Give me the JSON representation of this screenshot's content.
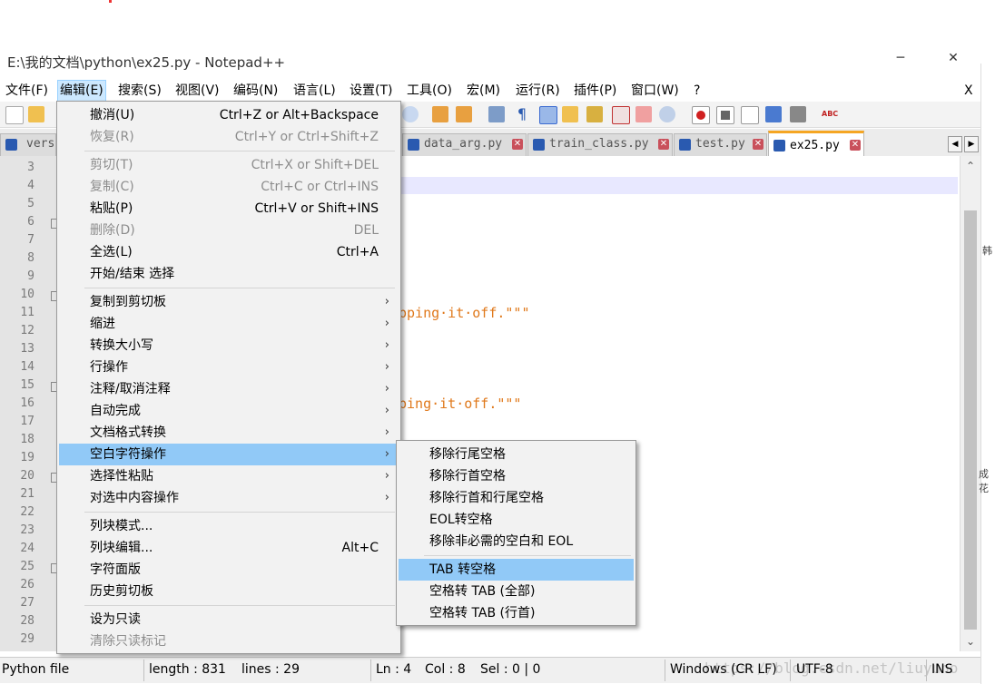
{
  "window": {
    "title": "E:\\我的文档\\python\\ex25.py - Notepad++",
    "minimize_label": "─",
    "close_label": "✕"
  },
  "menubar": {
    "items": [
      "文件(F)",
      "编辑(E)",
      "搜索(S)",
      "视图(V)",
      "编码(N)",
      "语言(L)",
      "设置(T)",
      "工具(O)",
      "宏(M)",
      "运行(R)",
      "插件(P)",
      "窗口(W)",
      "?"
    ],
    "close_label": "X"
  },
  "tabs": [
    {
      "name": "vers",
      "active": false
    },
    {
      "name": "data_arg.py",
      "active": false
    },
    {
      "name": "train_class.py",
      "active": false
    },
    {
      "name": "test.py",
      "active": false
    },
    {
      "name": "ex25.py",
      "active": true
    }
  ],
  "tab_close_glyph": "✕",
  "tab_nav": {
    "prev": "◀",
    "next": "▶"
  },
  "editor": {
    "line_numbers": [
      "3",
      "4",
      "5",
      "6",
      "7",
      "8",
      "9",
      "10",
      "11",
      "12",
      "13",
      "14",
      "15",
      "16",
      "17",
      "18",
      "19",
      "20",
      "21",
      "22",
      "23",
      "24",
      "25",
      "26",
      "27",
      "28",
      "29"
    ],
    "visible_code": [
      {
        "line": "11",
        "text": "pping·it·off.\"\"\""
      },
      {
        "line": "16",
        "text": "ping·it·off.\"\"\""
      }
    ]
  },
  "edit_menu": {
    "items": [
      {
        "label": "撤消(U)",
        "shortcut": "Ctrl+Z or Alt+Backspace",
        "disabled": false
      },
      {
        "label": "恢复(R)",
        "shortcut": "Ctrl+Y or Ctrl+Shift+Z",
        "disabled": true
      },
      {
        "label": "剪切(T)",
        "shortcut": "Ctrl+X or Shift+DEL",
        "disabled": true
      },
      {
        "label": "复制(C)",
        "shortcut": "Ctrl+C or Ctrl+INS",
        "disabled": true
      },
      {
        "label": "粘贴(P)",
        "shortcut": "Ctrl+V or Shift+INS",
        "disabled": false
      },
      {
        "label": "删除(D)",
        "shortcut": "DEL",
        "disabled": true
      },
      {
        "label": "全选(L)",
        "shortcut": "Ctrl+A",
        "disabled": false
      },
      {
        "label": "开始/结束 选择",
        "shortcut": "",
        "disabled": false
      },
      {
        "label": "复制到剪切板",
        "submenu": true
      },
      {
        "label": "缩进",
        "submenu": true
      },
      {
        "label": "转换大小写",
        "submenu": true
      },
      {
        "label": "行操作",
        "submenu": true
      },
      {
        "label": "注释/取消注释",
        "submenu": true
      },
      {
        "label": "自动完成",
        "submenu": true
      },
      {
        "label": "文档格式转换",
        "submenu": true
      },
      {
        "label": "空白字符操作",
        "submenu": true,
        "highlighted": true
      },
      {
        "label": "选择性粘贴",
        "submenu": true
      },
      {
        "label": "对选中内容操作",
        "submenu": true
      },
      {
        "label": "列块模式...",
        "shortcut": ""
      },
      {
        "label": "列块编辑...",
        "shortcut": "Alt+C"
      },
      {
        "label": "字符面版",
        "shortcut": ""
      },
      {
        "label": "历史剪切板",
        "shortcut": ""
      },
      {
        "label": "设为只读",
        "shortcut": ""
      },
      {
        "label": "清除只读标记",
        "shortcut": "",
        "disabled": true
      }
    ],
    "submenu_arrow": "›"
  },
  "whitespace_submenu": {
    "items": [
      {
        "label": "移除行尾空格"
      },
      {
        "label": "移除行首空格"
      },
      {
        "label": "移除行首和行尾空格"
      },
      {
        "label": "EOL转空格"
      },
      {
        "label": "移除非必需的空白和 EOL"
      },
      {
        "label": "TAB 转空格",
        "highlighted": true
      },
      {
        "label": "空格转 TAB (全部)"
      },
      {
        "label": "空格转 TAB (行首)"
      }
    ]
  },
  "statusbar": {
    "filetype": "Python file",
    "length": "length : 831",
    "lines": "lines : 29",
    "ln": "Ln : 4",
    "col": "Col : 8",
    "sel": "Sel : 0 | 0",
    "eol": "Windows (CR LF)",
    "encoding": "UTF-8",
    "mode": "INS",
    "watermark": "https://blog.csdn.net/liuyuno"
  },
  "scrollbar": {
    "up": "⌃",
    "down": "⌄"
  },
  "background_fragments": [
    "韩",
    "成花"
  ],
  "colors": {
    "highlight": "#91c9f7",
    "active_tab": "#f5a623",
    "string": "#e0791c",
    "current_line": "#e8e8ff"
  }
}
